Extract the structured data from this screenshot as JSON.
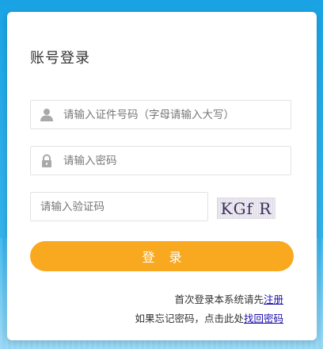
{
  "form": {
    "title": "账号登录",
    "id_field": {
      "placeholder": "请输入证件号码（字母请输入大写）",
      "value": "",
      "icon": "user-icon"
    },
    "password_field": {
      "placeholder": "请输入密码",
      "value": "",
      "icon": "lock-icon"
    },
    "captcha_field": {
      "placeholder": "请输入验证码",
      "value": ""
    },
    "captcha_text": "KGf R",
    "login_label": "登录",
    "register_prompt": "首次登录本系统请先",
    "register_link": "注册",
    "forgot_prompt": "如果忘记密码，点击此处",
    "forgot_link": "找回密码"
  },
  "colors": {
    "background": "#1aa3e4",
    "button": "#f9a91f",
    "link": "#1a0dab",
    "icon": "#a9a9a9"
  }
}
